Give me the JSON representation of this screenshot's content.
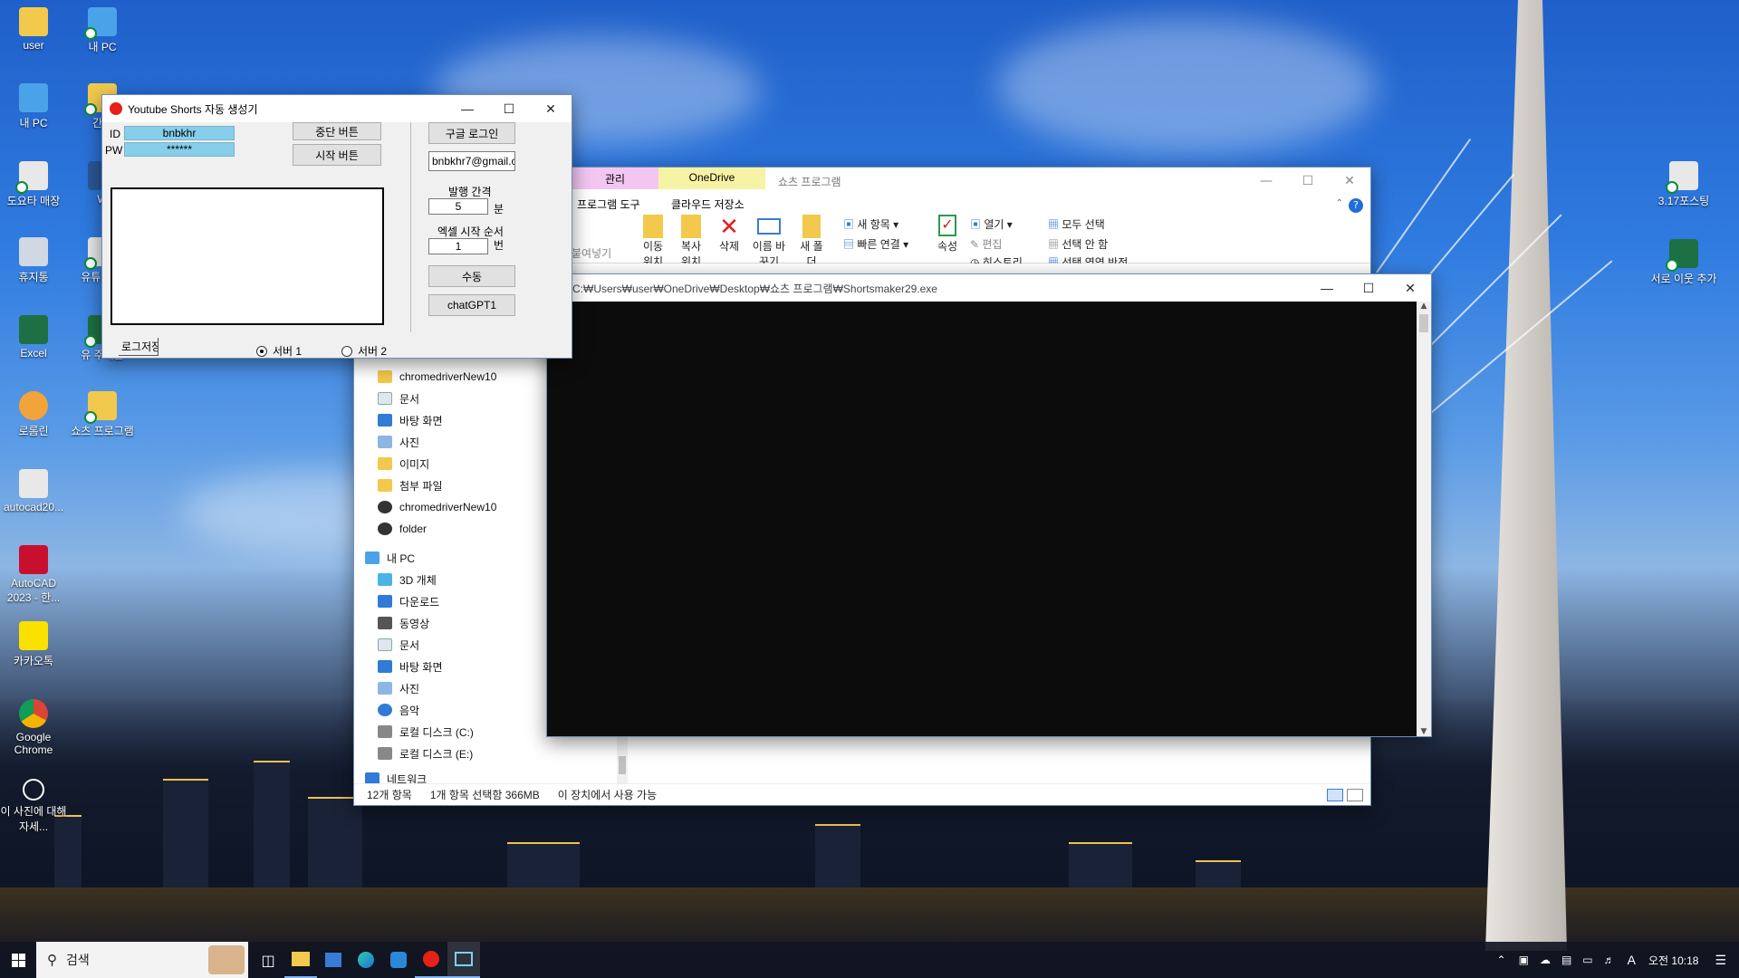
{
  "desktop": {
    "icons_left": [
      {
        "label": "user"
      },
      {
        "label": "내 PC"
      },
      {
        "label": "내 PC"
      },
      {
        "label": "간색"
      },
      {
        "label": "도요타 매장"
      },
      {
        "label": "W"
      },
      {
        "label": "휴지통"
      },
      {
        "label": "유튜브 생"
      },
      {
        "label": "Excel"
      },
      {
        "label": "유 주제들"
      },
      {
        "label": "로롬린"
      },
      {
        "label": "쇼츠 프로그램"
      },
      {
        "label": "autocad20..."
      },
      {
        "label": "AutoCAD 2023 - 한..."
      },
      {
        "label": "카카오톡"
      },
      {
        "label": "Google Chrome"
      },
      {
        "label": "이 사진에 대해 자세..."
      }
    ],
    "icons_right": [
      {
        "label": "3.17포스팅"
      },
      {
        "label": "서로 이웃 추가"
      }
    ]
  },
  "explorer": {
    "title": "쇼츠 프로그램",
    "ribbon_tabs": [
      "관리",
      "OneDrive"
    ],
    "ribbon_subtabs": [
      "프로그램 도구",
      "클라우드 저장소"
    ],
    "ribbon_buttons": {
      "paste": "붙여넣기",
      "move_to": "이동 위치",
      "copy_to": "복사 위치",
      "delete": "삭제",
      "rename": "이름 바꾸기",
      "new_folder": "새 폴더",
      "new_item": "새 항목",
      "quick_access": "빠른 연결",
      "properties": "속성",
      "open": "열기",
      "edit": "편집",
      "history": "히스토리",
      "select_all": "모두 선택",
      "select_none": "선택 안 함",
      "invert_selection": "선택 영역 반전"
    },
    "nav_items": [
      {
        "label": "chromedriverNew10",
        "icon": "folder-icon"
      },
      {
        "label": "문서",
        "icon": "document-icon"
      },
      {
        "label": "바탕 화면",
        "icon": "desktop-icon"
      },
      {
        "label": "사진",
        "icon": "pictures-icon"
      },
      {
        "label": "이미지",
        "icon": "folder-icon"
      },
      {
        "label": "첨부 파일",
        "icon": "folder-icon"
      },
      {
        "label": "chromedriverNew10",
        "icon": "zip-icon"
      },
      {
        "label": "folder",
        "icon": "zip-icon"
      },
      {
        "label": "내 PC",
        "icon": "pc-icon"
      },
      {
        "label": "3D 개체",
        "icon": "3d-icon"
      },
      {
        "label": "다운로드",
        "icon": "download-icon"
      },
      {
        "label": "동영상",
        "icon": "video-icon"
      },
      {
        "label": "문서",
        "icon": "document-icon"
      },
      {
        "label": "바탕 화면",
        "icon": "desktop-icon"
      },
      {
        "label": "사진",
        "icon": "pictures-icon"
      },
      {
        "label": "음악",
        "icon": "music-icon"
      },
      {
        "label": "로컬 디스크 (C:)",
        "icon": "disk-icon"
      },
      {
        "label": "로컬 디스크 (E:)",
        "icon": "disk-icon"
      },
      {
        "label": "네트워크",
        "icon": "network-icon"
      }
    ],
    "status": {
      "count": "12개 항목",
      "selected": "1개 항목 선택함 366MB",
      "availability": "이 장치에서 사용 가능"
    }
  },
  "console": {
    "title": "C:₩Users₩user₩OneDrive₩Desktop₩쇼츠 프로그램₩Shortsmaker29.exe"
  },
  "app": {
    "title": "Youtube Shorts 자동 생성기",
    "id_label": "ID",
    "id_value": "bnbkhr",
    "pw_label": "PW",
    "pw_value": "******",
    "stop_button": "중단 버튼",
    "start_button": "시작 버튼",
    "google_login": "구글 로그인",
    "email_value": "bnbkhr7@gmail.c",
    "interval_label": "발행 간격",
    "interval_value": "5",
    "interval_unit": "분",
    "excel_label": "엑셀 시작 순서",
    "excel_value": "1",
    "excel_unit": "번",
    "manual_button": "수동",
    "chatgpt_button": "chatGPT1",
    "log_save": "로그저장",
    "server1": "서버 1",
    "server2": "서버 2",
    "server_selected": 1
  },
  "taskbar": {
    "search_placeholder": "검색",
    "time": "오전 10:18",
    "ime": "A"
  }
}
